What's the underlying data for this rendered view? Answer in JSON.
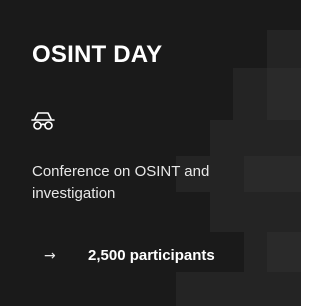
{
  "card": {
    "title": "OSINT DAY",
    "icon": "spy-glasses-icon",
    "description": "Conference on OSINT and investigation",
    "stat_arrow": "→",
    "stat_text": "2,500 participants"
  },
  "colors": {
    "background": "#1a1a1a",
    "decor": "#262626",
    "text": "#ffffff"
  }
}
